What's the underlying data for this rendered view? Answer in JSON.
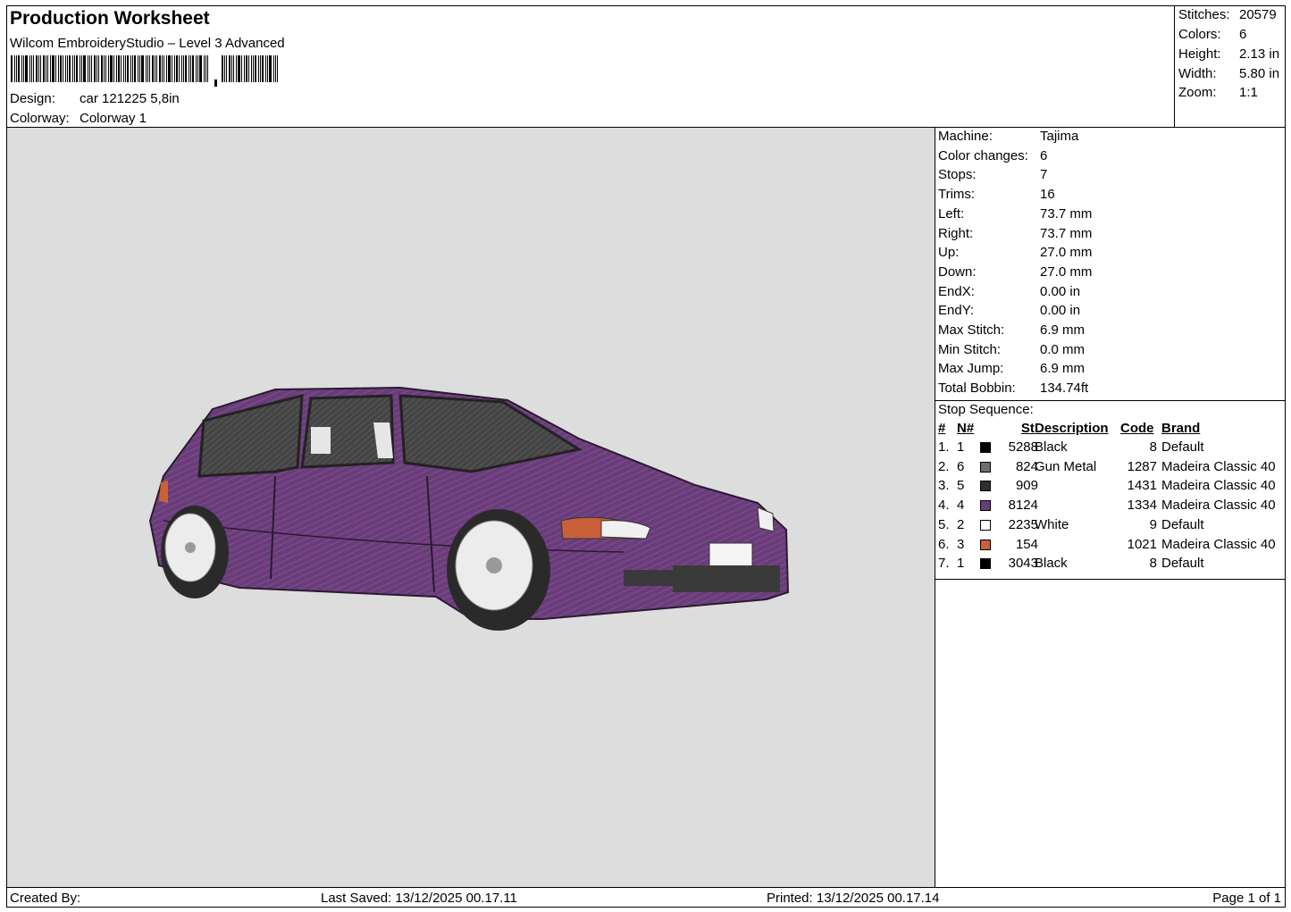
{
  "header": {
    "title": "Production Worksheet",
    "software": "Wilcom EmbroideryStudio – Level 3 Advanced",
    "design_label": "Design:",
    "design_value": "car 121225 5,8in",
    "colorway_label": "Colorway:",
    "colorway_value": "Colorway 1"
  },
  "stats": [
    {
      "label": "Stitches:",
      "value": "20579"
    },
    {
      "label": "Colors:",
      "value": "6"
    },
    {
      "label": "Height:",
      "value": "2.13 in"
    },
    {
      "label": "Width:",
      "value": "5.80 in"
    },
    {
      "label": "Zoom:",
      "value": "1:1"
    }
  ],
  "machine_info": [
    {
      "label": "Machine:",
      "value": "Tajima"
    },
    {
      "label": "Color changes:",
      "value": "6"
    },
    {
      "label": "Stops:",
      "value": "7"
    },
    {
      "label": "Trims:",
      "value": "16"
    },
    {
      "label": "Left:",
      "value": "73.7 mm"
    },
    {
      "label": "Right:",
      "value": "73.7 mm"
    },
    {
      "label": "Up:",
      "value": "27.0 mm"
    },
    {
      "label": "Down:",
      "value": "27.0 mm"
    },
    {
      "label": "EndX:",
      "value": "0.00 in"
    },
    {
      "label": "EndY:",
      "value": "0.00 in"
    },
    {
      "label": "Max Stitch:",
      "value": "6.9 mm"
    },
    {
      "label": "Min Stitch:",
      "value": "0.0 mm"
    },
    {
      "label": "Max Jump:",
      "value": "6.9 mm"
    },
    {
      "label": "Total Bobbin:",
      "value": "134.74ft"
    }
  ],
  "stop_sequence": {
    "title": "Stop Sequence:",
    "columns": [
      "#",
      "N#",
      "St.",
      "Description",
      "Code",
      "Brand"
    ],
    "rows": [
      {
        "num": "1.",
        "n": "1",
        "color": "#000000",
        "st": "5288",
        "desc": "Black",
        "code": "8",
        "brand": "Default"
      },
      {
        "num": "2.",
        "n": "6",
        "color": "#6e6e6e",
        "st": "824",
        "desc": "Gun Metal",
        "code": "1287",
        "brand": "Madeira Classic 40"
      },
      {
        "num": "3.",
        "n": "5",
        "color": "#2e2e2e",
        "st": "909",
        "desc": "",
        "code": "1431",
        "brand": "Madeira Classic 40"
      },
      {
        "num": "4.",
        "n": "4",
        "color": "#6a3d7a",
        "st": "8124",
        "desc": "",
        "code": "1334",
        "brand": "Madeira Classic 40"
      },
      {
        "num": "5.",
        "n": "2",
        "color": "#ffffff",
        "st": "2235",
        "desc": "White",
        "code": "9",
        "brand": "Default"
      },
      {
        "num": "6.",
        "n": "3",
        "color": "#c8603a",
        "st": "154",
        "desc": "",
        "code": "1021",
        "brand": "Madeira Classic 40"
      },
      {
        "num": "7.",
        "n": "1",
        "color": "#000000",
        "st": "3043",
        "desc": "Black",
        "code": "8",
        "brand": "Default"
      }
    ]
  },
  "footer": {
    "created_by": "Created By:",
    "last_saved": "Last Saved: 13/12/2025 00.17.11",
    "printed": "Printed: 13/12/2025 00.17.14",
    "page": "Page 1 of 1"
  },
  "colors": {
    "preview_bg": "#dddddd",
    "car_body": "#6a3d7a",
    "window": "#4a4a4a",
    "turn_signal": "#c8603a"
  }
}
